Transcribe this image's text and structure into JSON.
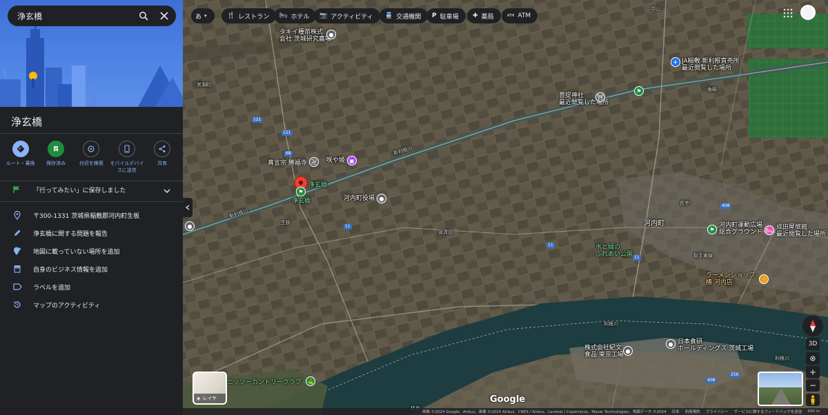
{
  "search": {
    "query": "浄玄橋"
  },
  "place": {
    "title": "浄玄橋"
  },
  "actions": [
    {
      "label": "ルート・乗換"
    },
    {
      "label": "保存済み"
    },
    {
      "label": "付近を検索"
    },
    {
      "label": "モバイルデバイ",
      "label2": "スに送信"
    },
    {
      "label": "共有"
    }
  ],
  "saved_notice": "「行ってみたい」に保存しました",
  "info": [
    {
      "text": "〒300-1331 茨城県稲敷郡河内町生板",
      "icon": "location-pin-icon"
    },
    {
      "text": "浄玄橋に関する問題を報告",
      "icon": "pencil-icon"
    },
    {
      "text": "地図に載っていない場所を追加",
      "icon": "add-location-icon"
    },
    {
      "text": "自身のビジネス情報を追加",
      "icon": "business-icon"
    },
    {
      "text": "ラベルを追加",
      "icon": "label-icon"
    },
    {
      "text": "マップのアクティビティ",
      "icon": "history-icon"
    }
  ],
  "map_chips": {
    "language": "あ",
    "restaurant": "レストラン",
    "hotel": "ホテル",
    "activity": "アクティビティ",
    "transit": "交通機関",
    "parking": "駐車場",
    "pharmacy": "薬局",
    "atm": "ATM"
  },
  "map_labels": {
    "takii_1": "タキイ種苗株式",
    "takii_2": "会社 茨城研究農場",
    "ja_1": "JA稲敷 新利根直売所",
    "ja_2": "最近閲覧した場所",
    "bodai_1": "菩提神社",
    "bodai_2": "最近閲覧した場所",
    "fukushoji": "真言宗 勝福寺",
    "sakuyahime": "咲や姫",
    "bridge_a": "浄玄橋",
    "bridge_b": "浄玄橋",
    "townhall": "河内町役場",
    "kawachi": "河内町",
    "park_1": "河内町運動広場",
    "park_2": "総合グラウンド",
    "ryokan_1": "成田屋旅館",
    "ryokan_2": "最近閲覧した場所",
    "fureai_1": "水と緑の",
    "fureai_2": "ふれあい公園",
    "ramen_1": "ラーメンショップ",
    "ramen_2": "椿 河内店",
    "kibun_1": "株式会社紀文",
    "kibun_2": "食品 東京工場",
    "nihon_1": "日本食研",
    "nihon_2": "ホールディングス 茨城工場",
    "country_1": "ニッソーカントリークラブ",
    "miyabuchi": "宮淵町",
    "namaita": "生板",
    "nagatoyo": "長竿",
    "kadozaki": "角崎",
    "nakayama": "中山",
    "shintone_river": "新利根川",
    "tone_river": "利根川",
    "sarushima": "猿島",
    "seido": "源清田",
    "torite": "取手東線",
    "shinri": "新利根川"
  },
  "road_numbers": [
    "121",
    "68",
    "11",
    "11",
    "11",
    "408",
    "408",
    "256"
  ],
  "layer_label": "レイヤ",
  "google_logo": "Google",
  "footer": {
    "copyright": "画像 ©2024 Google、Airbus、画像 ©2024 Airbus、CNES / Airbus、Landsat / Copernicus、Maxar Technologies、地図データ ©2024",
    "japan": "日本",
    "terms": "利用規約",
    "privacy": "プライバシー",
    "feedback": "サービスに関するフィードバックを送信",
    "scale": "500 m"
  },
  "controls": {
    "three_d": "3D"
  },
  "colors": {
    "accent": "#8ab4f8",
    "saved_green": "#1e8e3e",
    "pin_red": "#ea4335",
    "panel_bg": "#202124"
  }
}
